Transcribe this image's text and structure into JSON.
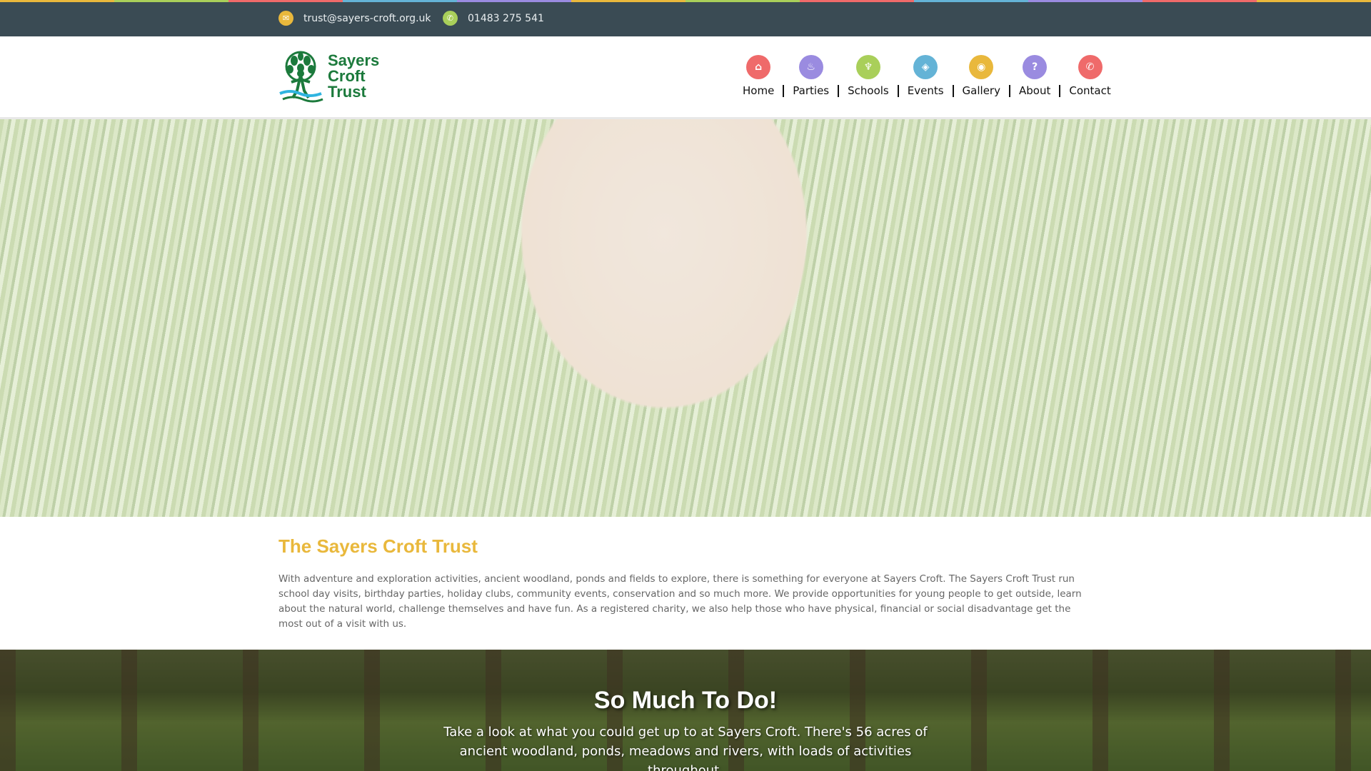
{
  "colors": {
    "topbar_bg": "#3a4b54",
    "rainbow": [
      "#e9b83c",
      "#a9cf5a",
      "#ef6a6a",
      "#64b3d6",
      "#9a8be0",
      "#e9b83c",
      "#a9cf5a",
      "#ef6a6a",
      "#64b3d6",
      "#9a8be0",
      "#ef6a6a",
      "#e9b83c"
    ],
    "heading": "#e9b83c",
    "logo_green": "#1c7a3c"
  },
  "topbar": {
    "email": {
      "icon": "envelope-icon",
      "text": "trust@sayers-croft.org.uk",
      "color": "#e9b83c"
    },
    "phone": {
      "icon": "phone-icon",
      "text": "01483 275 541",
      "color": "#a9cf5a"
    }
  },
  "logo": {
    "line1": "Sayers",
    "line2": "Croft",
    "line3": "Trust"
  },
  "nav": [
    {
      "label": "Home",
      "icon": "home-icon",
      "glyph": "⌂",
      "color": "#ef6a6a"
    },
    {
      "label": "Parties",
      "icon": "cake-icon",
      "glyph": "♨",
      "color": "#9a8be0"
    },
    {
      "label": "Schools",
      "icon": "torch-icon",
      "glyph": "♆",
      "color": "#a9cf5a"
    },
    {
      "label": "Events",
      "icon": "ticket-icon",
      "glyph": "◈",
      "color": "#64b3d6"
    },
    {
      "label": "Gallery",
      "icon": "camera-icon",
      "glyph": "◉",
      "color": "#e9b83c"
    },
    {
      "label": "About",
      "icon": "question-icon",
      "glyph": "?",
      "color": "#9a8be0"
    },
    {
      "label": "Contact",
      "icon": "phone-icon",
      "glyph": "✆",
      "color": "#ef6a6a"
    }
  ],
  "intro": {
    "title": "The Sayers Croft Trust",
    "body": "With adventure and exploration activities, ancient woodland, ponds and fields to explore, there is something for everyone at Sayers Croft. The Sayers Croft Trust run school day visits, birthday parties, holiday clubs, community events, conservation and so much more. We provide opportunities for young people to get outside, learn about the natural world, challenge themselves and have fun. As a registered charity, we also help those who have physical, financial or social disadvantage get the most out of a visit with us."
  },
  "todo": {
    "title": "So Much To Do!",
    "body": "Take a look at what you could get up to at Sayers Croft. There's 56 acres of ancient woodland, ponds, meadows and rivers, with loads of activities throughout."
  }
}
